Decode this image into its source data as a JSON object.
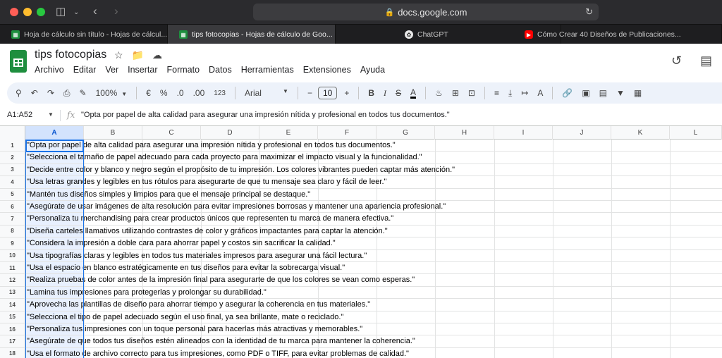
{
  "browser": {
    "url": "docs.google.com",
    "tabs": [
      {
        "label": "Hoja de cálculo sin título - Hojas de cálcul...",
        "favicon": "sheets-icon"
      },
      {
        "label": "tips fotocopias - Hojas de cálculo de Goo...",
        "favicon": "sheets-icon"
      },
      {
        "label": "ChatGPT",
        "favicon": "chatgpt-icon"
      },
      {
        "label": "Cómo Crear 40 Diseños de Publicaciones...",
        "favicon": "youtube-icon"
      }
    ]
  },
  "doc": {
    "title": "tips fotocopias",
    "menu": [
      "Archivo",
      "Editar",
      "Ver",
      "Insertar",
      "Formato",
      "Datos",
      "Herramientas",
      "Extensiones",
      "Ayuda"
    ]
  },
  "toolbar": {
    "zoom": "100%",
    "currency": "€",
    "percent": "%",
    "dec_decrease": ".0",
    "dec_increase": ".00",
    "number_format": "123",
    "font": "Arial",
    "font_size": "10",
    "minus": "−",
    "plus": "+"
  },
  "formula_bar": {
    "name_box": "A1:A52",
    "fx": "fx",
    "formula": "\"Opta por papel de alta calidad para asegurar una impresión nítida y profesional en todos tus documentos.\""
  },
  "grid": {
    "columns": [
      "A",
      "B",
      "C",
      "D",
      "E",
      "F",
      "G",
      "H",
      "I",
      "J",
      "K",
      "L"
    ],
    "rows": [
      {
        "n": "1",
        "text": "\"Opta por papel de alta calidad para asegurar una impresión nítida y profesional en todos tus documentos.\""
      },
      {
        "n": "2",
        "text": "\"Selecciona el tamaño de papel adecuado para cada proyecto para maximizar el impacto visual y la funcionalidad.\""
      },
      {
        "n": "3",
        "text": "\"Decide entre color y blanco y negro según el propósito de tu impresión. Los colores vibrantes pueden captar más atención.\""
      },
      {
        "n": "4",
        "text": "\"Usa letras grandes y legibles en tus rótulos para asegurarte de que tu mensaje sea claro y fácil de leer.\""
      },
      {
        "n": "5",
        "text": "\"Mantén tus diseños simples y limpios para que el mensaje principal se destaque.\""
      },
      {
        "n": "6",
        "text": "\"Asegúrate de usar imágenes de alta resolución para evitar impresiones borrosas y mantener una apariencia profesional.\""
      },
      {
        "n": "7",
        "text": "\"Personaliza tu merchandising para crear productos únicos que representen tu marca de manera efectiva.\""
      },
      {
        "n": "8",
        "text": "\"Diseña carteles llamativos utilizando contrastes de color y gráficos impactantes para captar la atención.\""
      },
      {
        "n": "9",
        "text": "\"Considera la impresión a doble cara para ahorrar papel y costos sin sacrificar la calidad.\""
      },
      {
        "n": "10",
        "text": "\"Usa tipografías claras y legibles en todos tus materiales impresos para asegurar una fácil lectura.\""
      },
      {
        "n": "11",
        "text": "\"Usa el espacio en blanco estratégicamente en tus diseños para evitar la sobrecarga visual.\""
      },
      {
        "n": "12",
        "text": "\"Realiza pruebas de color antes de la impresión final para asegurarte de que los colores se vean como esperas.\""
      },
      {
        "n": "13",
        "text": "\"Lamina tus impresiones para protegerlas y prolongar su durabilidad.\""
      },
      {
        "n": "14",
        "text": "\"Aprovecha las plantillas de diseño para ahorrar tiempo y asegurar la coherencia en tus materiales.\""
      },
      {
        "n": "15",
        "text": "\"Selecciona el tipo de papel adecuado según el uso final, ya sea brillante, mate o reciclado.\""
      },
      {
        "n": "16",
        "text": "\"Personaliza tus impresiones con un toque personal para hacerlas más atractivas y memorables.\""
      },
      {
        "n": "17",
        "text": "\"Asegúrate de que todos tus diseños estén alineados con la identidad de tu marca para mantener la coherencia.\""
      },
      {
        "n": "18",
        "text": "\"Usa el formato de archivo correcto para tus impresiones, como PDF o TIFF, para evitar problemas de calidad.\""
      }
    ]
  },
  "colors": {
    "accent": "#1a73e8",
    "toolbar_bg": "#edf2fa",
    "sheets_green": "#1e8e3e"
  }
}
